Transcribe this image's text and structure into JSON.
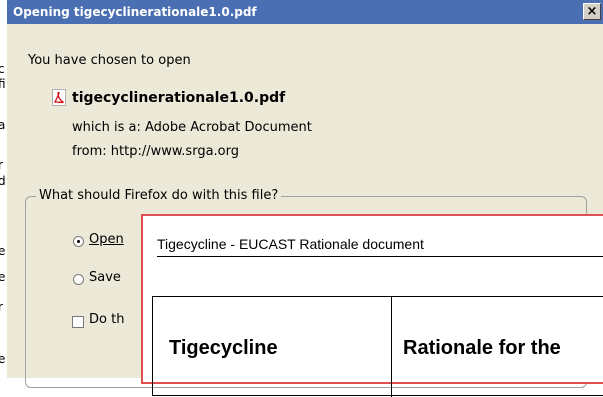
{
  "dialog": {
    "title": "Opening tigecyclinerationale1.0.pdf",
    "close_label": "×",
    "intro": "You have chosen to open",
    "file_name": "tigecyclinerationale1.0.pdf",
    "file_type_line": "which is a:  Adobe Acrobat Document",
    "from_line": "from: http://www.srga.org",
    "question": "What should Firefox do with this file?",
    "option_open": "Open",
    "option_save": "Save",
    "option_remember": "Do th"
  },
  "background": {
    "fragments": [
      "c",
      "fi",
      "a",
      "r",
      "d",
      "e",
      "e",
      "r",
      "e"
    ]
  },
  "overlay": {
    "header": "Tigecycline - EUCAST Rationale document",
    "cell_left": "Tigecycline",
    "cell_right": "Rationale for the"
  },
  "colors": {
    "titlebar": "#4a6fb3",
    "dialog_bg": "#ece9d8",
    "overlay_border": "#e05050"
  }
}
